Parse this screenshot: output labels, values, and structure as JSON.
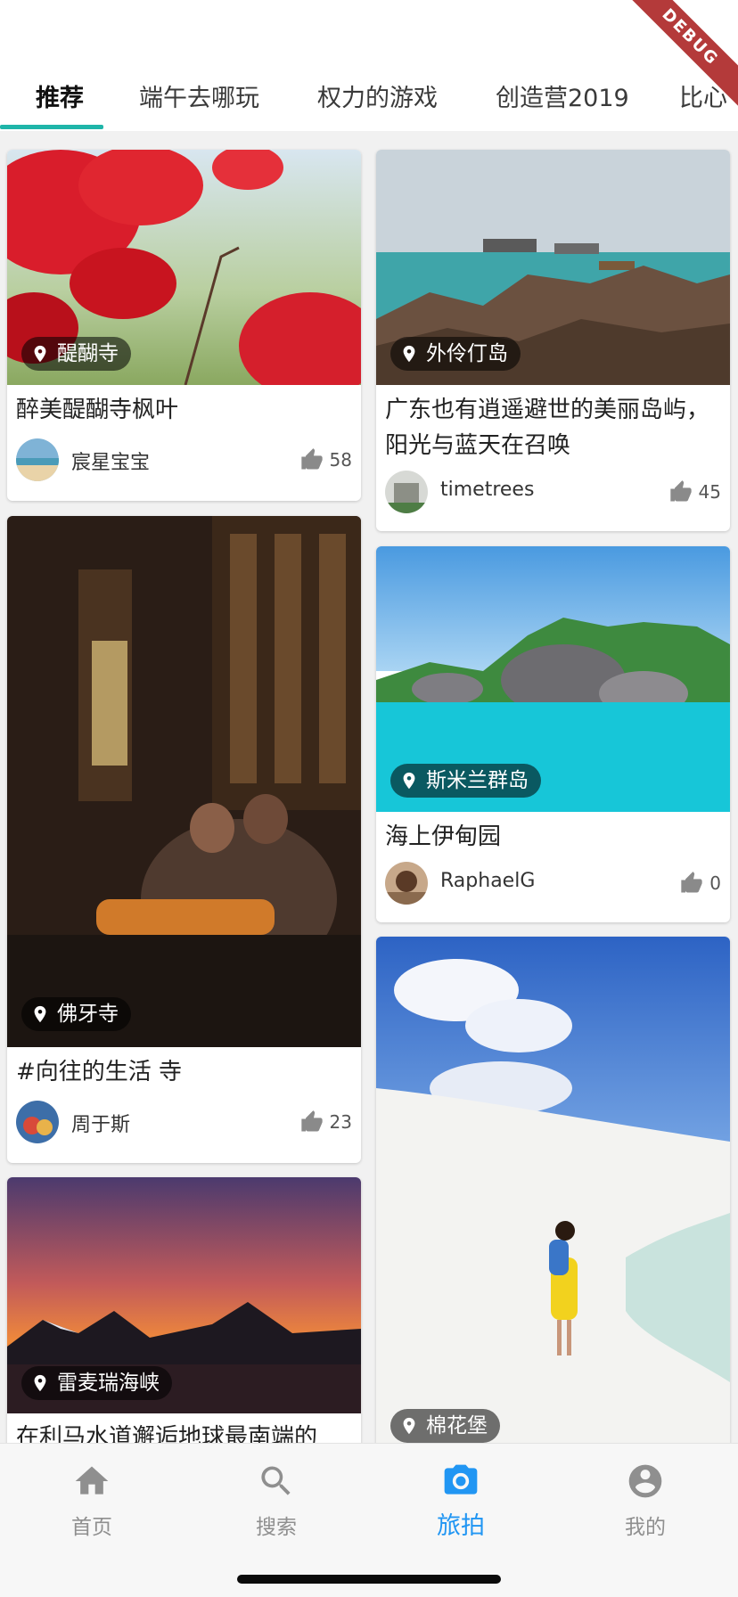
{
  "debug_banner": "DEBUG",
  "tabs": [
    {
      "label": "推荐",
      "active": true
    },
    {
      "label": "端午去哪玩",
      "active": false
    },
    {
      "label": "权力的游戏",
      "active": false
    },
    {
      "label": "创造营2019",
      "active": false
    },
    {
      "label": "比心",
      "active": false
    }
  ],
  "colors": {
    "accent": "#1fb5a9",
    "nav_active": "#2196f3",
    "nav_inactive": "#8f8f8f",
    "badge_bg": "rgba(0,0,0,0.55)"
  },
  "cards": [
    {
      "location": "醍醐寺",
      "title": "醉美醍醐寺枫叶",
      "user": "宸星宝宝",
      "likes": "58",
      "image": "red-maple-leaves-photo"
    },
    {
      "location": "外伶仃岛",
      "title": "广东也有逍遥避世的美丽岛屿，阳光与蓝天在召唤",
      "user": "timetrees",
      "likes": "45",
      "image": "rocky-seashore-photo"
    },
    {
      "location": "佛牙寺",
      "title": "#向往的生活 寺",
      "user": "周于斯",
      "likes": "23",
      "image": "temple-worshippers-photo"
    },
    {
      "location": "斯米兰群岛",
      "title": "海上伊甸园",
      "user": "RaphaelG",
      "likes": "0",
      "image": "turquoise-island-photo"
    },
    {
      "location": "雷麦瑞海峡",
      "title": "在利马水道邂逅地球最南端的",
      "image": "antarctic-sunset-photo"
    },
    {
      "location": "棉花堡",
      "image": "white-travertine-photo"
    }
  ],
  "bottom_nav": [
    {
      "label": "首页",
      "icon": "home-icon",
      "active": false
    },
    {
      "label": "搜索",
      "icon": "search-icon",
      "active": false
    },
    {
      "label": "旅拍",
      "icon": "camera-icon",
      "active": true
    },
    {
      "label": "我的",
      "icon": "account-icon",
      "active": false
    }
  ]
}
